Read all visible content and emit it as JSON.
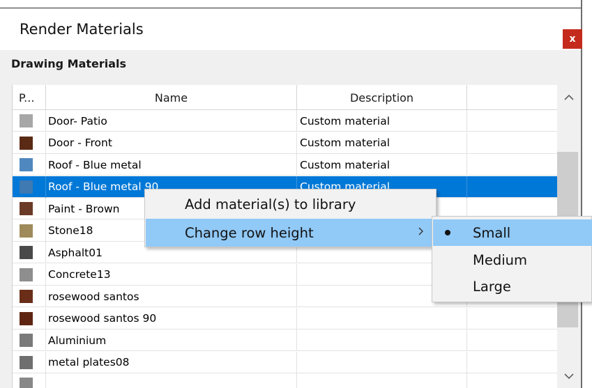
{
  "window": {
    "title": "Render Materials",
    "close_label": "x"
  },
  "section": {
    "title": "Drawing Materials"
  },
  "table": {
    "columns": [
      "P...",
      "Name",
      "Description",
      ""
    ],
    "rows": [
      {
        "name": "Door- Patio",
        "description": "Custom material",
        "color": "#a7a7a7"
      },
      {
        "name": "Door - Front",
        "description": "Custom material",
        "color": "#5a2a14"
      },
      {
        "name": "Roof - Blue metal",
        "description": "Custom material",
        "color": "#4f88be"
      },
      {
        "name": "Roof - Blue metal 90",
        "description": "Custom material",
        "color": "#3f7ab2",
        "selected": true
      },
      {
        "name": "Paint - Brown",
        "description": "",
        "color": "#6b3a26"
      },
      {
        "name": "Stone18",
        "description": "",
        "color": "#9e8a5a"
      },
      {
        "name": "Asphalt01",
        "description": "",
        "color": "#4a4a4a"
      },
      {
        "name": "Concrete13",
        "description": "",
        "color": "#8e8e8e"
      },
      {
        "name": "rosewood santos",
        "description": "",
        "color": "#6a2e18"
      },
      {
        "name": "rosewood santos 90",
        "description": "",
        "color": "#5e2612"
      },
      {
        "name": "Aluminium",
        "description": "",
        "color": "#7a7a7a"
      },
      {
        "name": "metal plates08",
        "description": "",
        "color": "#6f6f6f"
      },
      {
        "name": "",
        "description": "",
        "color": "#888888"
      }
    ]
  },
  "context_menu": {
    "items": [
      {
        "label": "Add material(s) to library",
        "has_submenu": false
      },
      {
        "label": "Change row height",
        "has_submenu": true,
        "highlighted": true
      }
    ]
  },
  "submenu": {
    "items": [
      {
        "label": "Small",
        "checked": true
      },
      {
        "label": "Medium",
        "checked": false
      },
      {
        "label": "Large",
        "checked": false
      }
    ]
  },
  "icons": {
    "scroll_up": "chevron-up-icon",
    "scroll_down": "chevron-down-icon",
    "submenu_arrow": "chevron-right-icon",
    "radio_checked": "bullet-icon"
  },
  "colors": {
    "selection": "#0078d7",
    "menu_highlight": "#91c9f7",
    "close_button": "#c42b1c"
  }
}
